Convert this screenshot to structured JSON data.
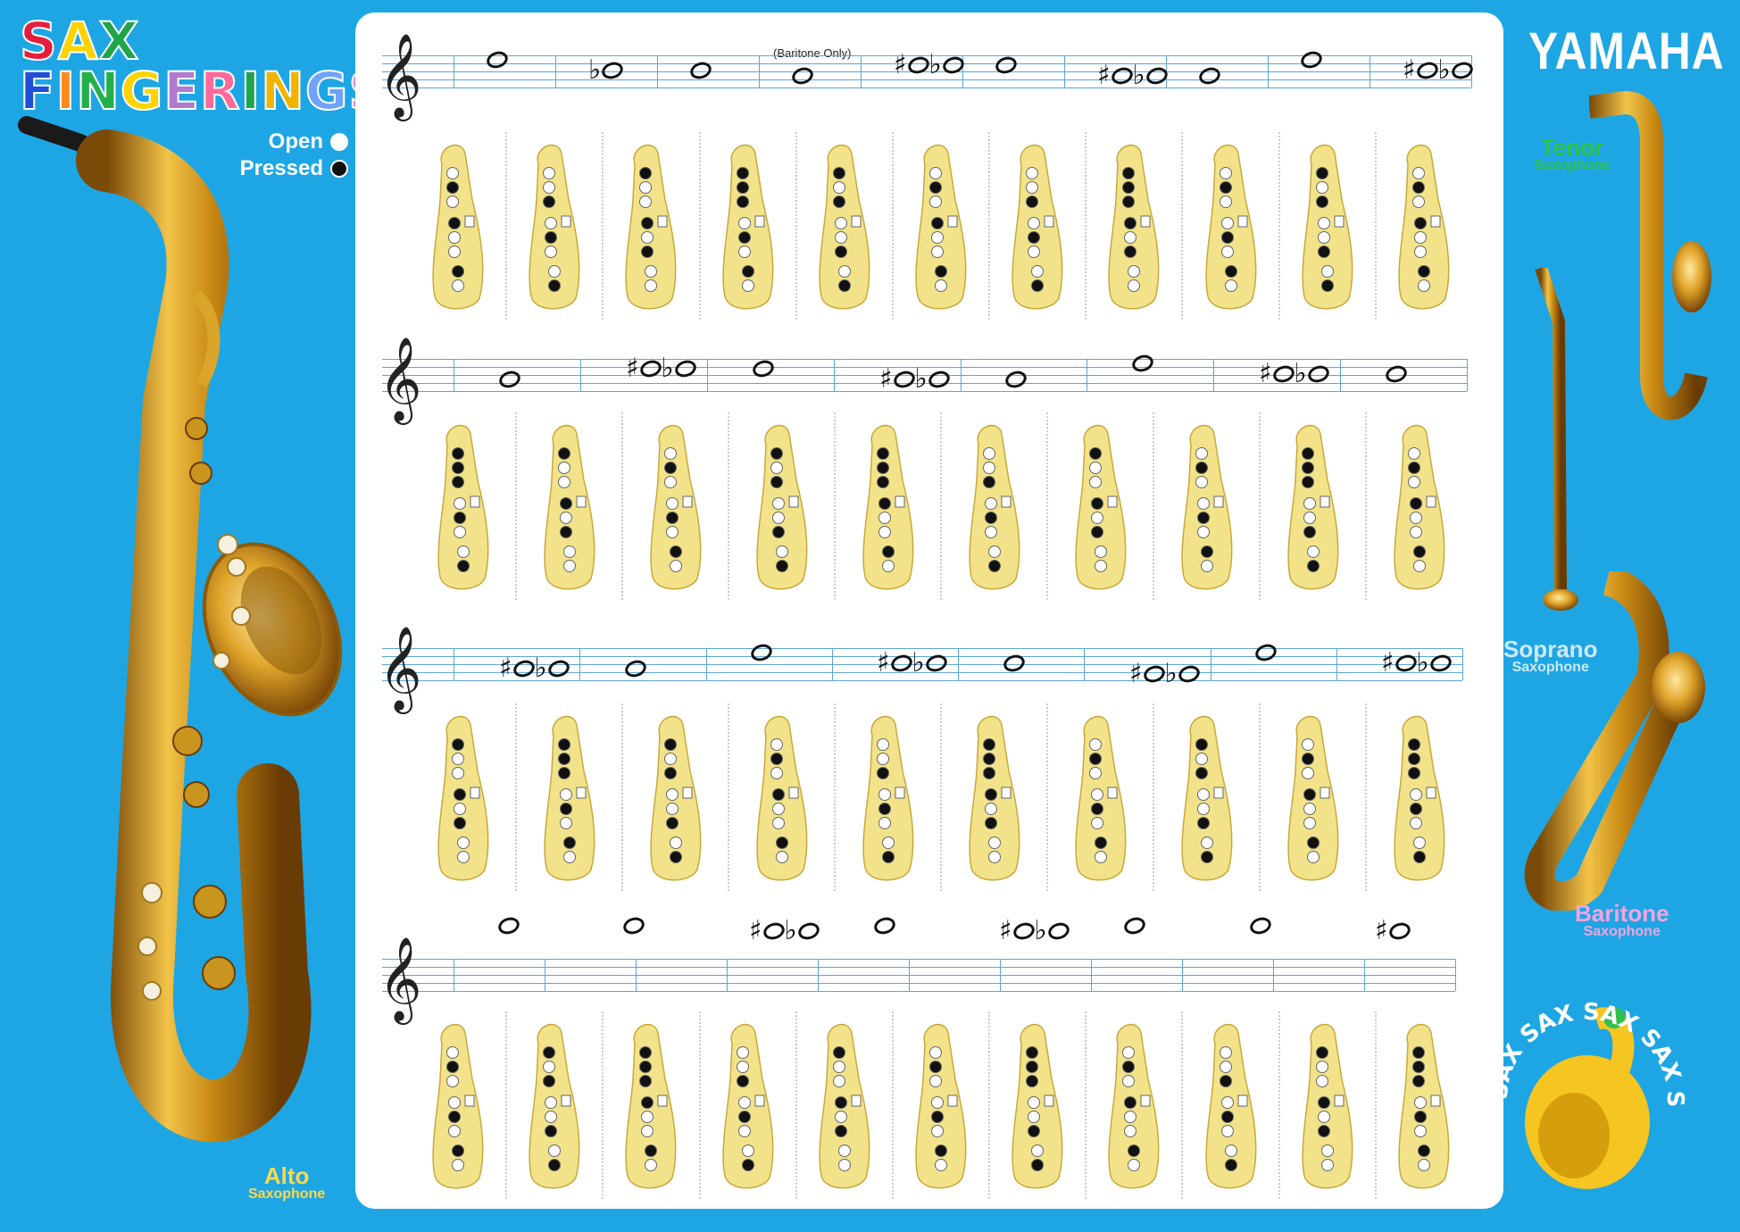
{
  "title": {
    "line1": [
      "S",
      "A",
      "X"
    ],
    "line1_colors": [
      "#e51e3d",
      "#ffd200",
      "#1fa44a"
    ],
    "line2": [
      "F",
      "I",
      "N",
      "G",
      "E",
      "R",
      "I",
      "N",
      "G",
      "S"
    ],
    "line2_colors": [
      "#1f4fd8",
      "#ff8a1c",
      "#22b04a",
      "#ffd200",
      "#b07ad0",
      "#ff6a9a",
      "#1fa44a",
      "#f0b400",
      "#6fa3ff",
      "#e58ad6"
    ]
  },
  "legend": {
    "open_label": "Open",
    "pressed_label": "Pressed"
  },
  "brand": "YAMAHA",
  "saxophones": {
    "tenor": {
      "name": "Tenor",
      "sub": "Saxophone"
    },
    "soprano": {
      "name": "Soprano",
      "sub": "Saxophone"
    },
    "baritone": {
      "name": "Baritone",
      "sub": "Saxophone"
    },
    "alto": {
      "name": "Alto",
      "sub": "Saxophone"
    }
  },
  "sheet": {
    "baritone_only": "(Baritone Only)",
    "rows": [
      {
        "notes": [
          "o",
          "bo",
          "o",
          "o",
          "#obo",
          "o",
          "#obo",
          "o",
          "o",
          "#obo"
        ],
        "diagrams": 11
      },
      {
        "notes": [
          "o",
          "#obo",
          "o",
          "#obo",
          "o",
          "o",
          "#obo",
          "o"
        ],
        "diagrams": 10
      },
      {
        "notes": [
          "#obo",
          "o",
          "o",
          "#obo",
          "o",
          "#obo",
          "o",
          "#obo"
        ],
        "diagrams": 10
      },
      {
        "notes": [
          "o",
          "o",
          "#obo",
          "o",
          "#obo",
          "o",
          "o",
          "#o"
        ],
        "diagrams": 11
      }
    ]
  },
  "badge_text": "SAX SAX SAX SAX SAX",
  "colors": {
    "background": "#1ea6e4",
    "sheet": "#ffffff",
    "key_body": "#f2e38a",
    "brass": "#c9951f"
  }
}
